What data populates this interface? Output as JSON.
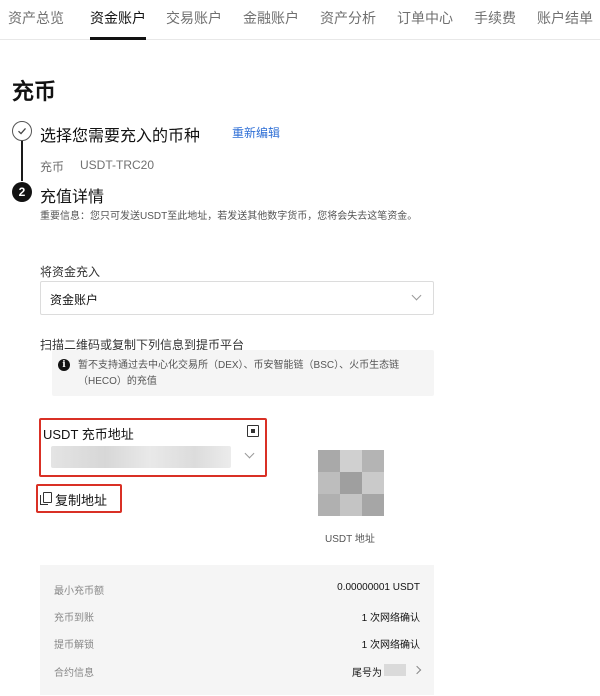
{
  "nav": {
    "tabs": [
      {
        "label": "资产总览"
      },
      {
        "label": "资金账户"
      },
      {
        "label": "交易账户"
      },
      {
        "label": "金融账户"
      },
      {
        "label": "资产分析"
      },
      {
        "label": "订单中心"
      },
      {
        "label": "手续费"
      },
      {
        "label": "账户结单"
      }
    ],
    "active_index": 1
  },
  "page": {
    "title": "充币"
  },
  "step1": {
    "title": "选择您需要充入的币种",
    "reselect_label": "重新编辑",
    "coin_label": "充币",
    "coin_value": "USDT-TRC20"
  },
  "step2": {
    "number": "2",
    "title": "充值详情",
    "notice": "重要信息：您只可发送USDT至此地址，若发送其他数字货币，您将会失去这笔资金。"
  },
  "deposit_to": {
    "label": "将资金充入",
    "selected": "资金账户"
  },
  "scan": {
    "label": "扫描二维码或复制下列信息到提币平台",
    "warning": "暂不支持通过去中心化交易所（DEX）、币安智能链（BSC）、火币生态链（HECO）的充值"
  },
  "address": {
    "label": "USDT 充币地址",
    "copy_label": "复制地址",
    "qr_caption": "USDT 地址"
  },
  "info": [
    {
      "key": "最小充币额",
      "value": "0.00000001 USDT"
    },
    {
      "key": "充币到账",
      "value": "1 次网络确认"
    },
    {
      "key": "提币解锁",
      "value": "1 次网络确认"
    },
    {
      "key": "合约信息",
      "value": "尾号为"
    }
  ],
  "colors": {
    "accent_link": "#2f6fd6",
    "highlight_border": "#d93025"
  },
  "icons": {
    "step1": "check-icon",
    "warning": "info-icon",
    "address_qr": "qr-code-icon",
    "copy": "copy-icon",
    "select": "chevron-down-icon"
  }
}
